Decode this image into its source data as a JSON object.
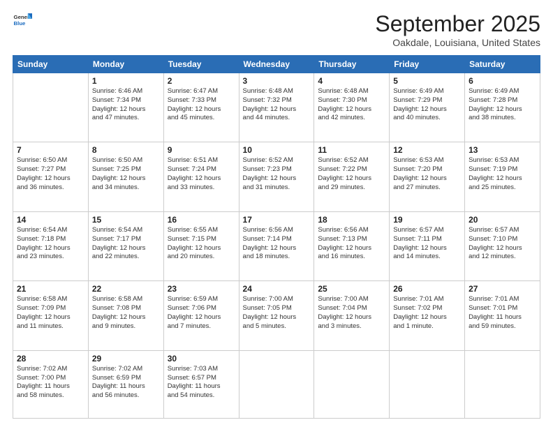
{
  "header": {
    "logo": {
      "line1": "General",
      "line2": "Blue"
    },
    "title": "September 2025",
    "subtitle": "Oakdale, Louisiana, United States"
  },
  "days_of_week": [
    "Sunday",
    "Monday",
    "Tuesday",
    "Wednesday",
    "Thursday",
    "Friday",
    "Saturday"
  ],
  "weeks": [
    [
      {
        "day": "",
        "info": ""
      },
      {
        "day": "1",
        "info": "Sunrise: 6:46 AM\nSunset: 7:34 PM\nDaylight: 12 hours\nand 47 minutes."
      },
      {
        "day": "2",
        "info": "Sunrise: 6:47 AM\nSunset: 7:33 PM\nDaylight: 12 hours\nand 45 minutes."
      },
      {
        "day": "3",
        "info": "Sunrise: 6:48 AM\nSunset: 7:32 PM\nDaylight: 12 hours\nand 44 minutes."
      },
      {
        "day": "4",
        "info": "Sunrise: 6:48 AM\nSunset: 7:30 PM\nDaylight: 12 hours\nand 42 minutes."
      },
      {
        "day": "5",
        "info": "Sunrise: 6:49 AM\nSunset: 7:29 PM\nDaylight: 12 hours\nand 40 minutes."
      },
      {
        "day": "6",
        "info": "Sunrise: 6:49 AM\nSunset: 7:28 PM\nDaylight: 12 hours\nand 38 minutes."
      }
    ],
    [
      {
        "day": "7",
        "info": "Sunrise: 6:50 AM\nSunset: 7:27 PM\nDaylight: 12 hours\nand 36 minutes."
      },
      {
        "day": "8",
        "info": "Sunrise: 6:50 AM\nSunset: 7:25 PM\nDaylight: 12 hours\nand 34 minutes."
      },
      {
        "day": "9",
        "info": "Sunrise: 6:51 AM\nSunset: 7:24 PM\nDaylight: 12 hours\nand 33 minutes."
      },
      {
        "day": "10",
        "info": "Sunrise: 6:52 AM\nSunset: 7:23 PM\nDaylight: 12 hours\nand 31 minutes."
      },
      {
        "day": "11",
        "info": "Sunrise: 6:52 AM\nSunset: 7:22 PM\nDaylight: 12 hours\nand 29 minutes."
      },
      {
        "day": "12",
        "info": "Sunrise: 6:53 AM\nSunset: 7:20 PM\nDaylight: 12 hours\nand 27 minutes."
      },
      {
        "day": "13",
        "info": "Sunrise: 6:53 AM\nSunset: 7:19 PM\nDaylight: 12 hours\nand 25 minutes."
      }
    ],
    [
      {
        "day": "14",
        "info": "Sunrise: 6:54 AM\nSunset: 7:18 PM\nDaylight: 12 hours\nand 23 minutes."
      },
      {
        "day": "15",
        "info": "Sunrise: 6:54 AM\nSunset: 7:17 PM\nDaylight: 12 hours\nand 22 minutes."
      },
      {
        "day": "16",
        "info": "Sunrise: 6:55 AM\nSunset: 7:15 PM\nDaylight: 12 hours\nand 20 minutes."
      },
      {
        "day": "17",
        "info": "Sunrise: 6:56 AM\nSunset: 7:14 PM\nDaylight: 12 hours\nand 18 minutes."
      },
      {
        "day": "18",
        "info": "Sunrise: 6:56 AM\nSunset: 7:13 PM\nDaylight: 12 hours\nand 16 minutes."
      },
      {
        "day": "19",
        "info": "Sunrise: 6:57 AM\nSunset: 7:11 PM\nDaylight: 12 hours\nand 14 minutes."
      },
      {
        "day": "20",
        "info": "Sunrise: 6:57 AM\nSunset: 7:10 PM\nDaylight: 12 hours\nand 12 minutes."
      }
    ],
    [
      {
        "day": "21",
        "info": "Sunrise: 6:58 AM\nSunset: 7:09 PM\nDaylight: 12 hours\nand 11 minutes."
      },
      {
        "day": "22",
        "info": "Sunrise: 6:58 AM\nSunset: 7:08 PM\nDaylight: 12 hours\nand 9 minutes."
      },
      {
        "day": "23",
        "info": "Sunrise: 6:59 AM\nSunset: 7:06 PM\nDaylight: 12 hours\nand 7 minutes."
      },
      {
        "day": "24",
        "info": "Sunrise: 7:00 AM\nSunset: 7:05 PM\nDaylight: 12 hours\nand 5 minutes."
      },
      {
        "day": "25",
        "info": "Sunrise: 7:00 AM\nSunset: 7:04 PM\nDaylight: 12 hours\nand 3 minutes."
      },
      {
        "day": "26",
        "info": "Sunrise: 7:01 AM\nSunset: 7:02 PM\nDaylight: 12 hours\nand 1 minute."
      },
      {
        "day": "27",
        "info": "Sunrise: 7:01 AM\nSunset: 7:01 PM\nDaylight: 11 hours\nand 59 minutes."
      }
    ],
    [
      {
        "day": "28",
        "info": "Sunrise: 7:02 AM\nSunset: 7:00 PM\nDaylight: 11 hours\nand 58 minutes."
      },
      {
        "day": "29",
        "info": "Sunrise: 7:02 AM\nSunset: 6:59 PM\nDaylight: 11 hours\nand 56 minutes."
      },
      {
        "day": "30",
        "info": "Sunrise: 7:03 AM\nSunset: 6:57 PM\nDaylight: 11 hours\nand 54 minutes."
      },
      {
        "day": "",
        "info": ""
      },
      {
        "day": "",
        "info": ""
      },
      {
        "day": "",
        "info": ""
      },
      {
        "day": "",
        "info": ""
      }
    ]
  ]
}
